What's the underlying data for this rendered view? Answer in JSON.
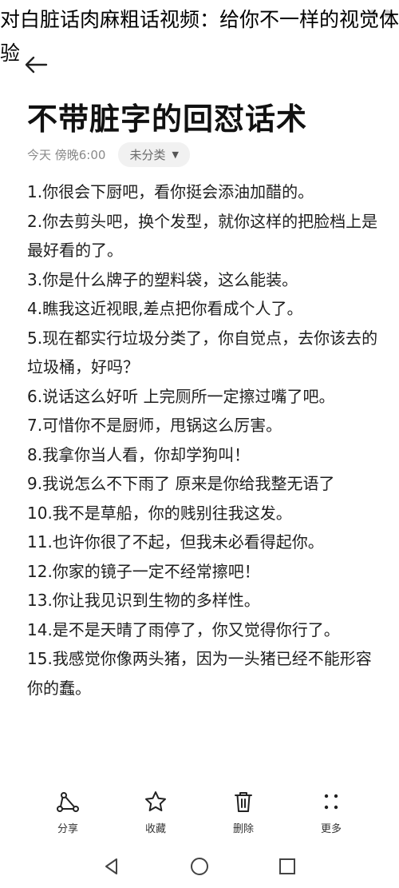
{
  "overlay": {
    "title": "对白脏话肉麻粗话视频：给你不一样的视觉体验"
  },
  "note": {
    "title": "不带脏字的回怼话术",
    "date": "今天 傍晚6:00",
    "category": "未分类",
    "lines": [
      "1.你很会下厨吧，看你挺会添油加醋的。",
      "2.你去剪头吧，换个发型，就你这样的把脸档上是最好看的了。",
      "3.你是什么牌子的塑料袋，这么能装。",
      "4.瞧我这近视眼,差点把你看成个人了。",
      "5.现在都实行垃圾分类了，你自觉点，去你该去的垃圾桶，好吗？",
      "6.说话这么好听 上完厕所一定擦过嘴了吧。",
      "7.可惜你不是厨师，甩锅这么厉害。",
      "8.我拿你当人看，你却学狗叫！",
      "9.我说怎么不下雨了 原来是你给我整无语了",
      "10.我不是草船，你的贱别往我这发。",
      "11.也许你很了不起，但我未必看得起你。",
      "12.你家的镜子一定不经常擦吧！",
      "13.你让我见识到生物的多样性。",
      "14.是不是天晴了雨停了，你又觉得你行了。",
      "15.我感觉你像两头猪，因为一头猪已经不能形容你的蠢。"
    ]
  },
  "toolbar": {
    "share": "分享",
    "favorite": "收藏",
    "delete": "删除",
    "more": "更多"
  },
  "icons": {
    "back": "arrow-left-icon",
    "share": "share-nodes-icon",
    "favorite": "star-icon",
    "delete": "trash-icon",
    "more": "dots-grid-icon",
    "nav_back": "triangle-back-icon",
    "nav_home": "circle-home-icon",
    "nav_recents": "square-recents-icon"
  }
}
